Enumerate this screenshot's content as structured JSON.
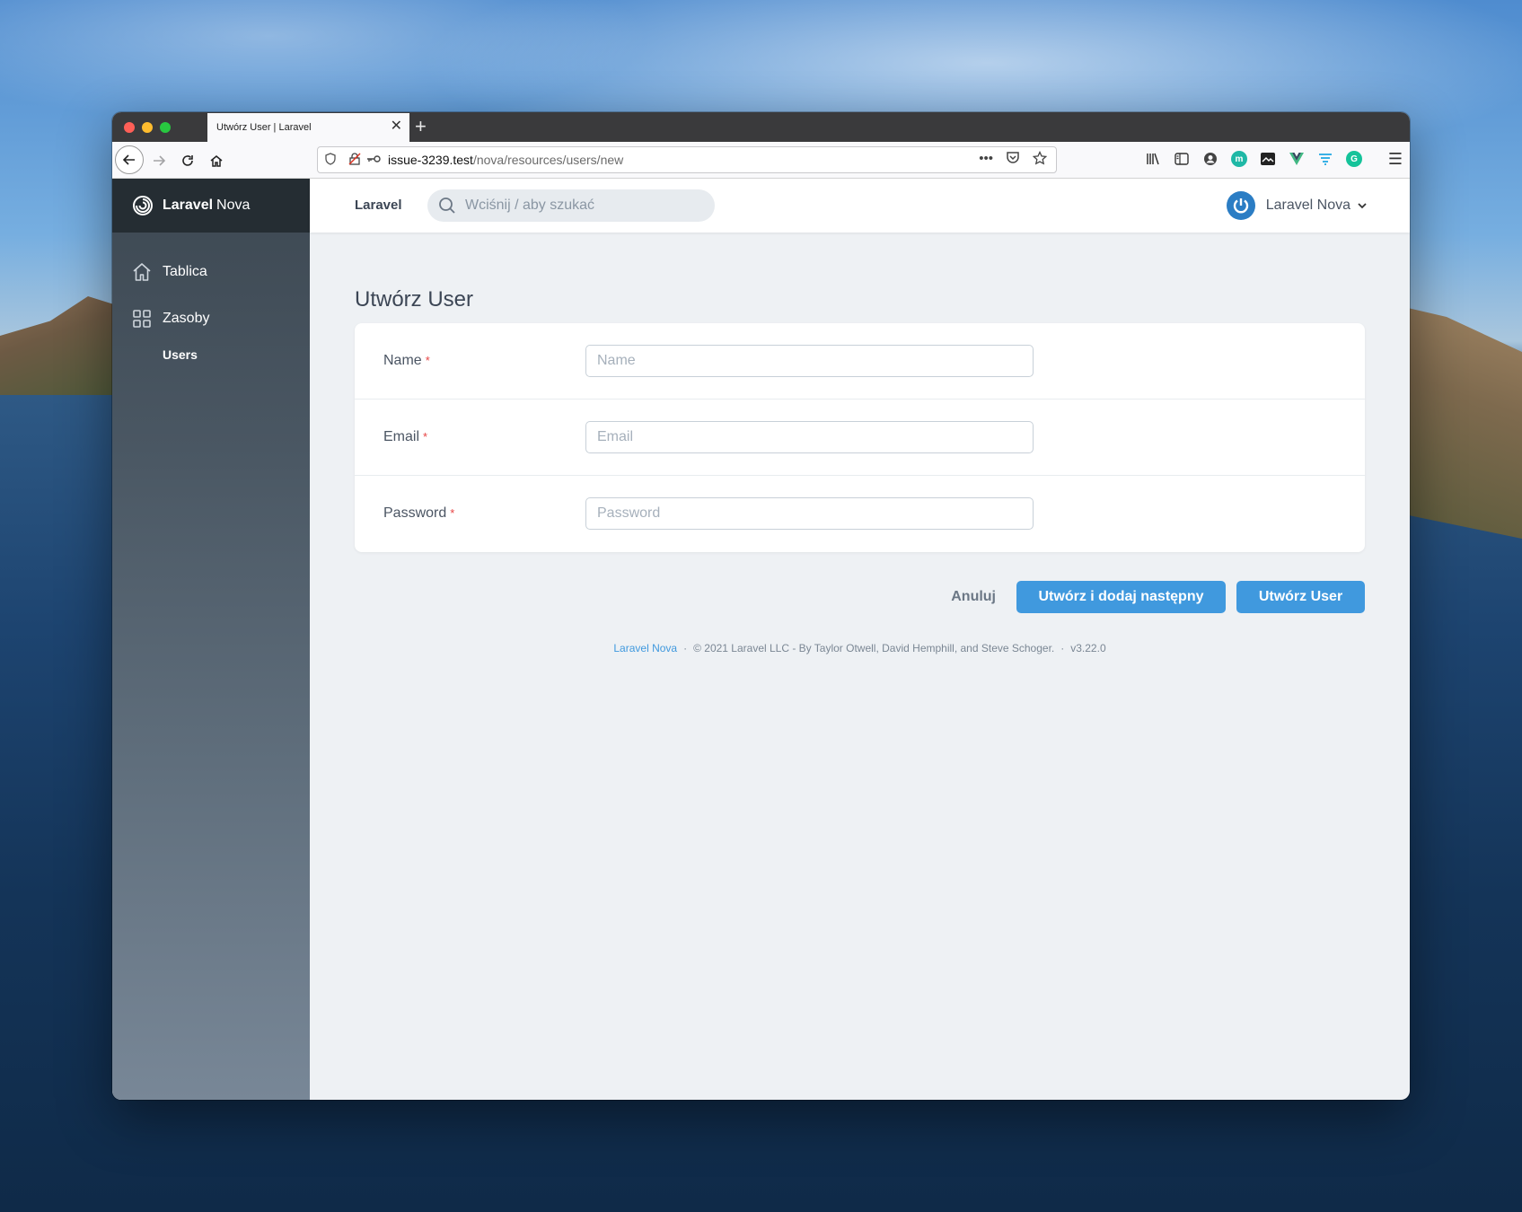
{
  "browser": {
    "tab_title": "Utwórz User | Laravel",
    "url_host": "issue-3239.test",
    "url_path": "/nova/resources/users/new"
  },
  "sidebar": {
    "brand_bold": "Laravel",
    "brand_rest": "Nova",
    "items": [
      {
        "label": "Tablica",
        "icon": "home-icon"
      },
      {
        "label": "Zasoby",
        "icon": "grid-icon"
      }
    ],
    "sub_items": [
      {
        "label": "Users"
      }
    ]
  },
  "header": {
    "app_name": "Laravel",
    "search_placeholder": "Wciśnij / aby szukać",
    "user_name": "Laravel Nova"
  },
  "page": {
    "title": "Utwórz User",
    "fields": [
      {
        "label": "Name",
        "required": "*",
        "placeholder": "Name",
        "value": ""
      },
      {
        "label": "Email",
        "required": "*",
        "placeholder": "Email",
        "value": ""
      },
      {
        "label": "Password",
        "required": "*",
        "placeholder": "Password",
        "value": ""
      }
    ],
    "actions": {
      "cancel": "Anuluj",
      "create_next": "Utwórz i dodaj następny",
      "create": "Utwórz User"
    }
  },
  "footer": {
    "link": "Laravel Nova",
    "copyright": "© 2021 Laravel LLC - By Taylor Otwell, David Hemphill, and Steve Schoger.",
    "version": "v3.22.0"
  },
  "colors": {
    "primary": "#4099de",
    "sidebar_dark": "#252d33",
    "required": "#e74444"
  }
}
